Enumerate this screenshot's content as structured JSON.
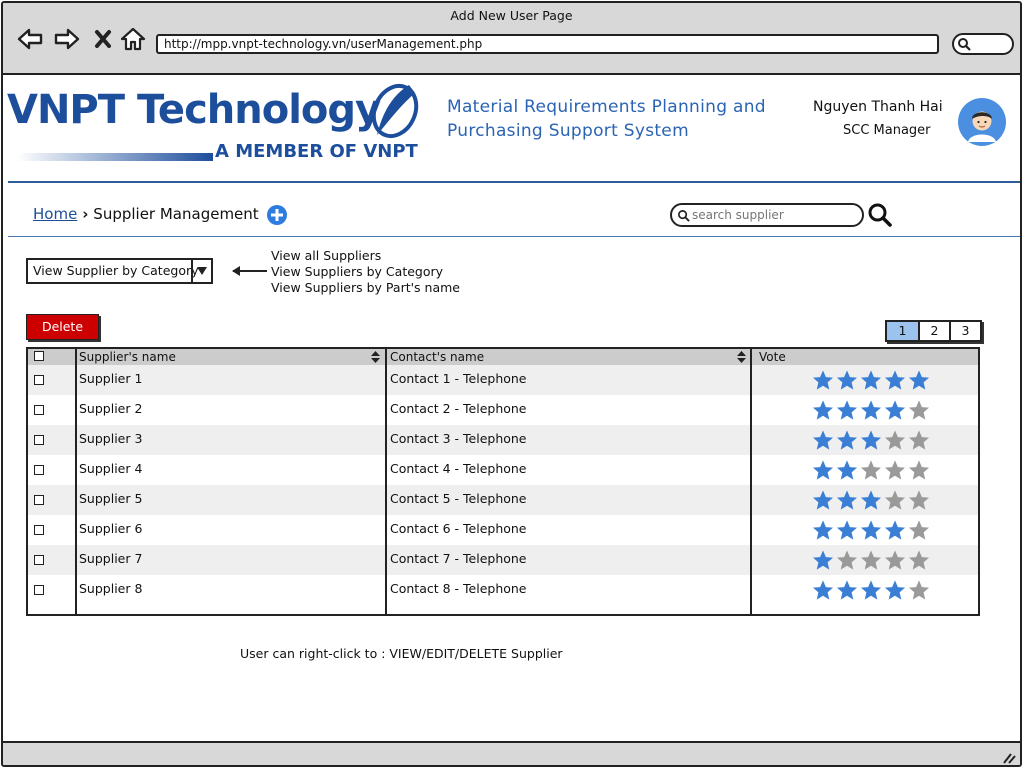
{
  "browser": {
    "title": "Add New User Page",
    "url": "http://mpp.vnpt-technology.vn/userManagement.php"
  },
  "header": {
    "logo_name": "VNPT Technology",
    "logo_tagline": "A MEMBER OF VNPT",
    "system_title": "Material Requirements Planning and Purchasing Support System",
    "user_name": "Nguyen Thanh Hai",
    "user_role": "SCC Manager",
    "brand_color": "#1d4e9c",
    "accent_color": "#2a64b3"
  },
  "breadcrumb": {
    "home": "Home",
    "current": "Supplier Management"
  },
  "search": {
    "placeholder": "search supplier"
  },
  "filter": {
    "selected": "View Supplier by Category",
    "options": [
      "View all Suppliers",
      "View Suppliers by Category",
      "View Suppliers by Part's name"
    ]
  },
  "actions": {
    "delete_label": "Delete",
    "delete_color": "#cc0000"
  },
  "pagination": {
    "pages": [
      "1",
      "2",
      "3"
    ],
    "current": 1
  },
  "table": {
    "columns": [
      "Supplier's name",
      "Contact's name",
      "Vote"
    ],
    "max_stars": 5,
    "rows": [
      {
        "name": "Supplier 1",
        "contact": "Contact 1 - Telephone",
        "rating": 5
      },
      {
        "name": "Supplier 2",
        "contact": "Contact 2 - Telephone",
        "rating": 4
      },
      {
        "name": "Supplier 3",
        "contact": "Contact 3 - Telephone",
        "rating": 3
      },
      {
        "name": "Supplier 4",
        "contact": "Contact 4 - Telephone",
        "rating": 2
      },
      {
        "name": "Supplier 5",
        "contact": "Contact 5 - Telephone",
        "rating": 3
      },
      {
        "name": "Supplier 6",
        "contact": "Contact 6 - Telephone",
        "rating": 4
      },
      {
        "name": "Supplier 7",
        "contact": "Contact 7 - Telephone",
        "rating": 1
      },
      {
        "name": "Supplier 8",
        "contact": "Contact 8 - Telephone",
        "rating": 4
      }
    ],
    "star_on_color": "#3a7fd5",
    "star_off_color": "#9a9a9a"
  },
  "hint": "User can right-click to : VIEW/EDIT/DELETE Supplier",
  "icons": [
    "back-arrow-icon",
    "forward-arrow-icon",
    "close-icon",
    "home-icon",
    "search-icon",
    "add-circle-icon",
    "sort-icon",
    "star-icon",
    "user-avatar-icon",
    "chevron-down-icon",
    "resize-grip-icon"
  ]
}
